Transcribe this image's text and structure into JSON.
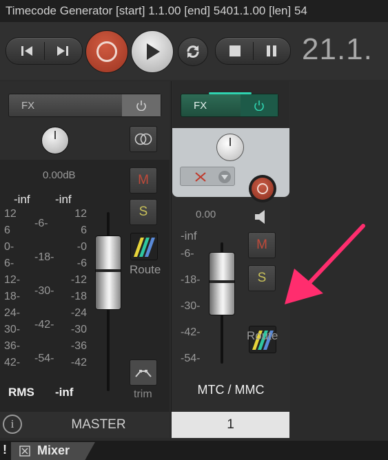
{
  "window": {
    "title": "Timecode Generator [start] 1.1.00 [end] 5401.1.00 [len] 54"
  },
  "transport": {
    "timecode": "21.1."
  },
  "master": {
    "fx_label": "FX",
    "volume": "0.00dB",
    "peak_left": "-inf",
    "peak_right": "-inf",
    "scale_left": [
      "12",
      "6",
      "0-",
      "6-",
      "12-",
      "18-",
      "24-",
      "30-",
      "36-",
      "42-"
    ],
    "scale_mid": [
      "-6-",
      "-18-",
      "-30-",
      "-42-",
      "-54-"
    ],
    "scale_right": [
      "12",
      "6",
      "-0",
      "-6",
      "-12",
      "-18",
      "-24",
      "-30",
      "-36",
      "-42"
    ],
    "mute_label": "M",
    "solo_label": "S",
    "route_label": "Route",
    "trim_label": "trim",
    "rms_label": "RMS",
    "rms_value": "-inf",
    "name": "MASTER"
  },
  "track": {
    "fx_label": "FX",
    "volume": "0.00",
    "peak": "-inf",
    "scale": [
      "-6-",
      "-18-",
      "-30-",
      "-42-",
      "-54-"
    ],
    "mute_label": "M",
    "solo_label": "S",
    "route_label": "Route",
    "name": "MTC / MMC",
    "number": "1"
  },
  "tabs": {
    "mixer_label": "Mixer",
    "warning_mark": "!"
  },
  "colors": {
    "record": "#b8452e",
    "fx_active": "#2fd3b0",
    "annotation_arrow": "#ff2d6e"
  }
}
